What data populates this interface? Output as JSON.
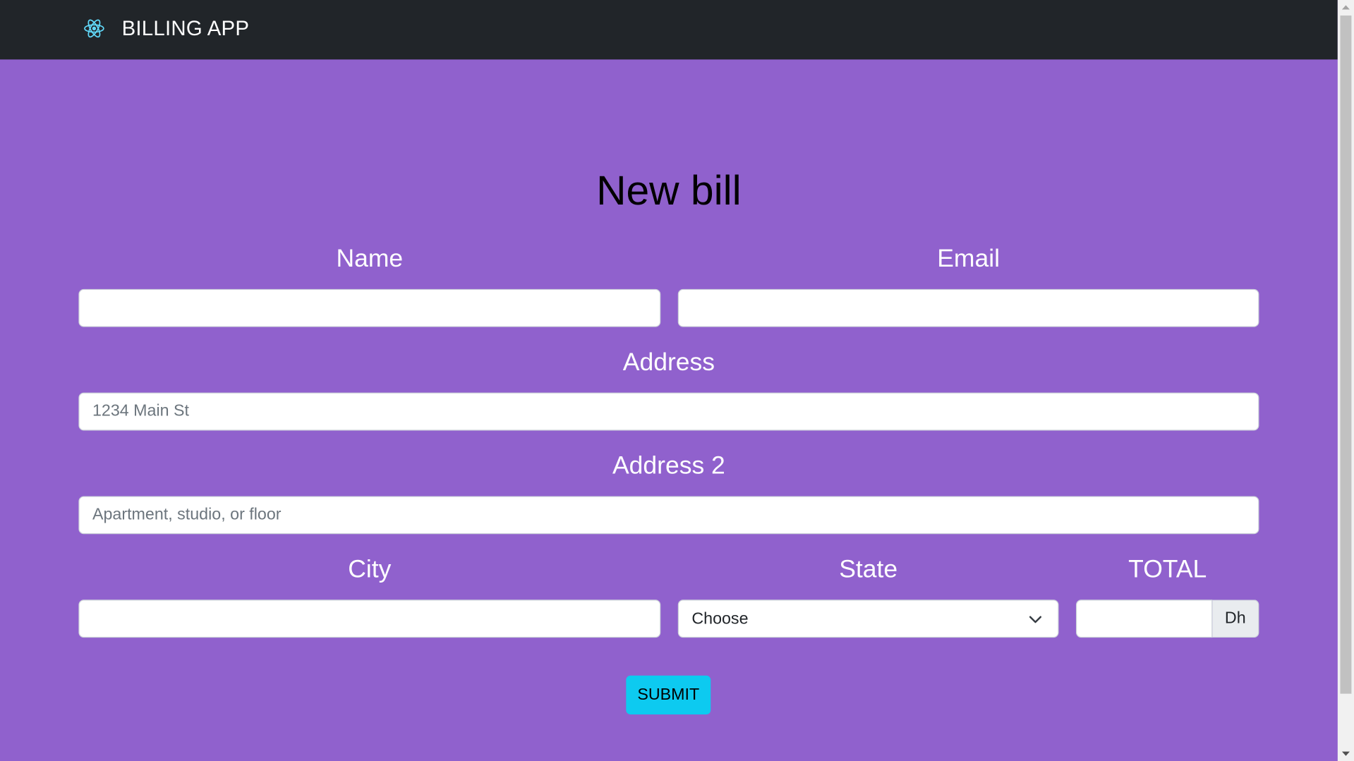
{
  "navbar": {
    "brand_title": "BILLING APP",
    "logo_icon": "react-atom-icon",
    "background": "#212529",
    "logo_color": "#61dafb"
  },
  "page": {
    "title": "New bill",
    "background": "#9061cd"
  },
  "form": {
    "name": {
      "label": "Name",
      "value": "",
      "placeholder": ""
    },
    "email": {
      "label": "Email",
      "value": "",
      "placeholder": ""
    },
    "address": {
      "label": "Address",
      "value": "",
      "placeholder": "1234 Main St"
    },
    "address2": {
      "label": "Address 2",
      "value": "",
      "placeholder": "Apartment, studio, or floor"
    },
    "city": {
      "label": "City",
      "value": "",
      "placeholder": ""
    },
    "state": {
      "label": "State",
      "selected": "Choose",
      "icon": "chevron-down-icon"
    },
    "total": {
      "label": "TOTAL",
      "value": "",
      "placeholder": "",
      "suffix": "Dh"
    },
    "submit_label": "SUBMIT",
    "submit_color": "#0dcaf0"
  }
}
